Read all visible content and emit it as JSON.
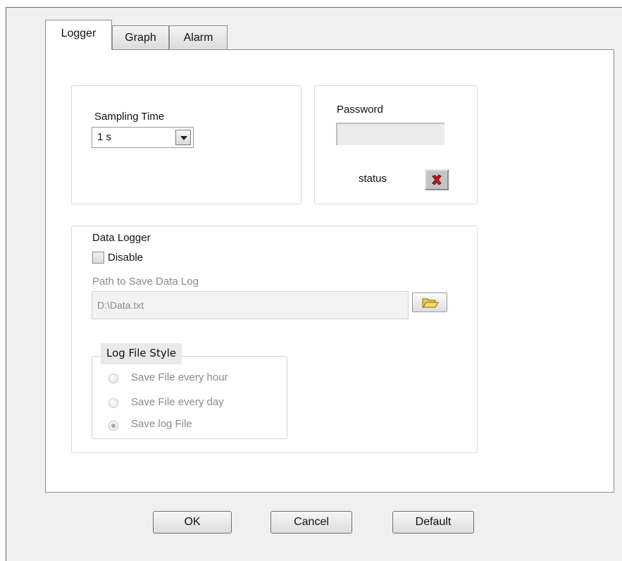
{
  "tabs": [
    {
      "label": "Logger",
      "active": true
    },
    {
      "label": "Graph",
      "active": false
    },
    {
      "label": "Alarm",
      "active": false
    }
  ],
  "sampling": {
    "label": "Sampling Time",
    "selected": "1 s"
  },
  "password": {
    "label": "Password",
    "value": "",
    "status_label": "status",
    "status_icon": "red-x-icon"
  },
  "data_logger": {
    "title": "Data Logger",
    "disable_label": "Disable",
    "disable_checked": false,
    "path_label": "Path to Save Data Log",
    "path_value": "D:\\Data.txt",
    "browse_icon": "folder-open-icon"
  },
  "log_file_style": {
    "title": "Log File Style",
    "options": [
      {
        "label": "Save File every hour",
        "selected": false
      },
      {
        "label": "Save File every day",
        "selected": false
      },
      {
        "label": "Save log File",
        "selected": true
      }
    ]
  },
  "buttons": {
    "ok": "OK",
    "cancel": "Cancel",
    "default": "Default"
  },
  "colors": {
    "status_x": "#cc1a1a",
    "disabled_text": "#8a8a8a"
  }
}
